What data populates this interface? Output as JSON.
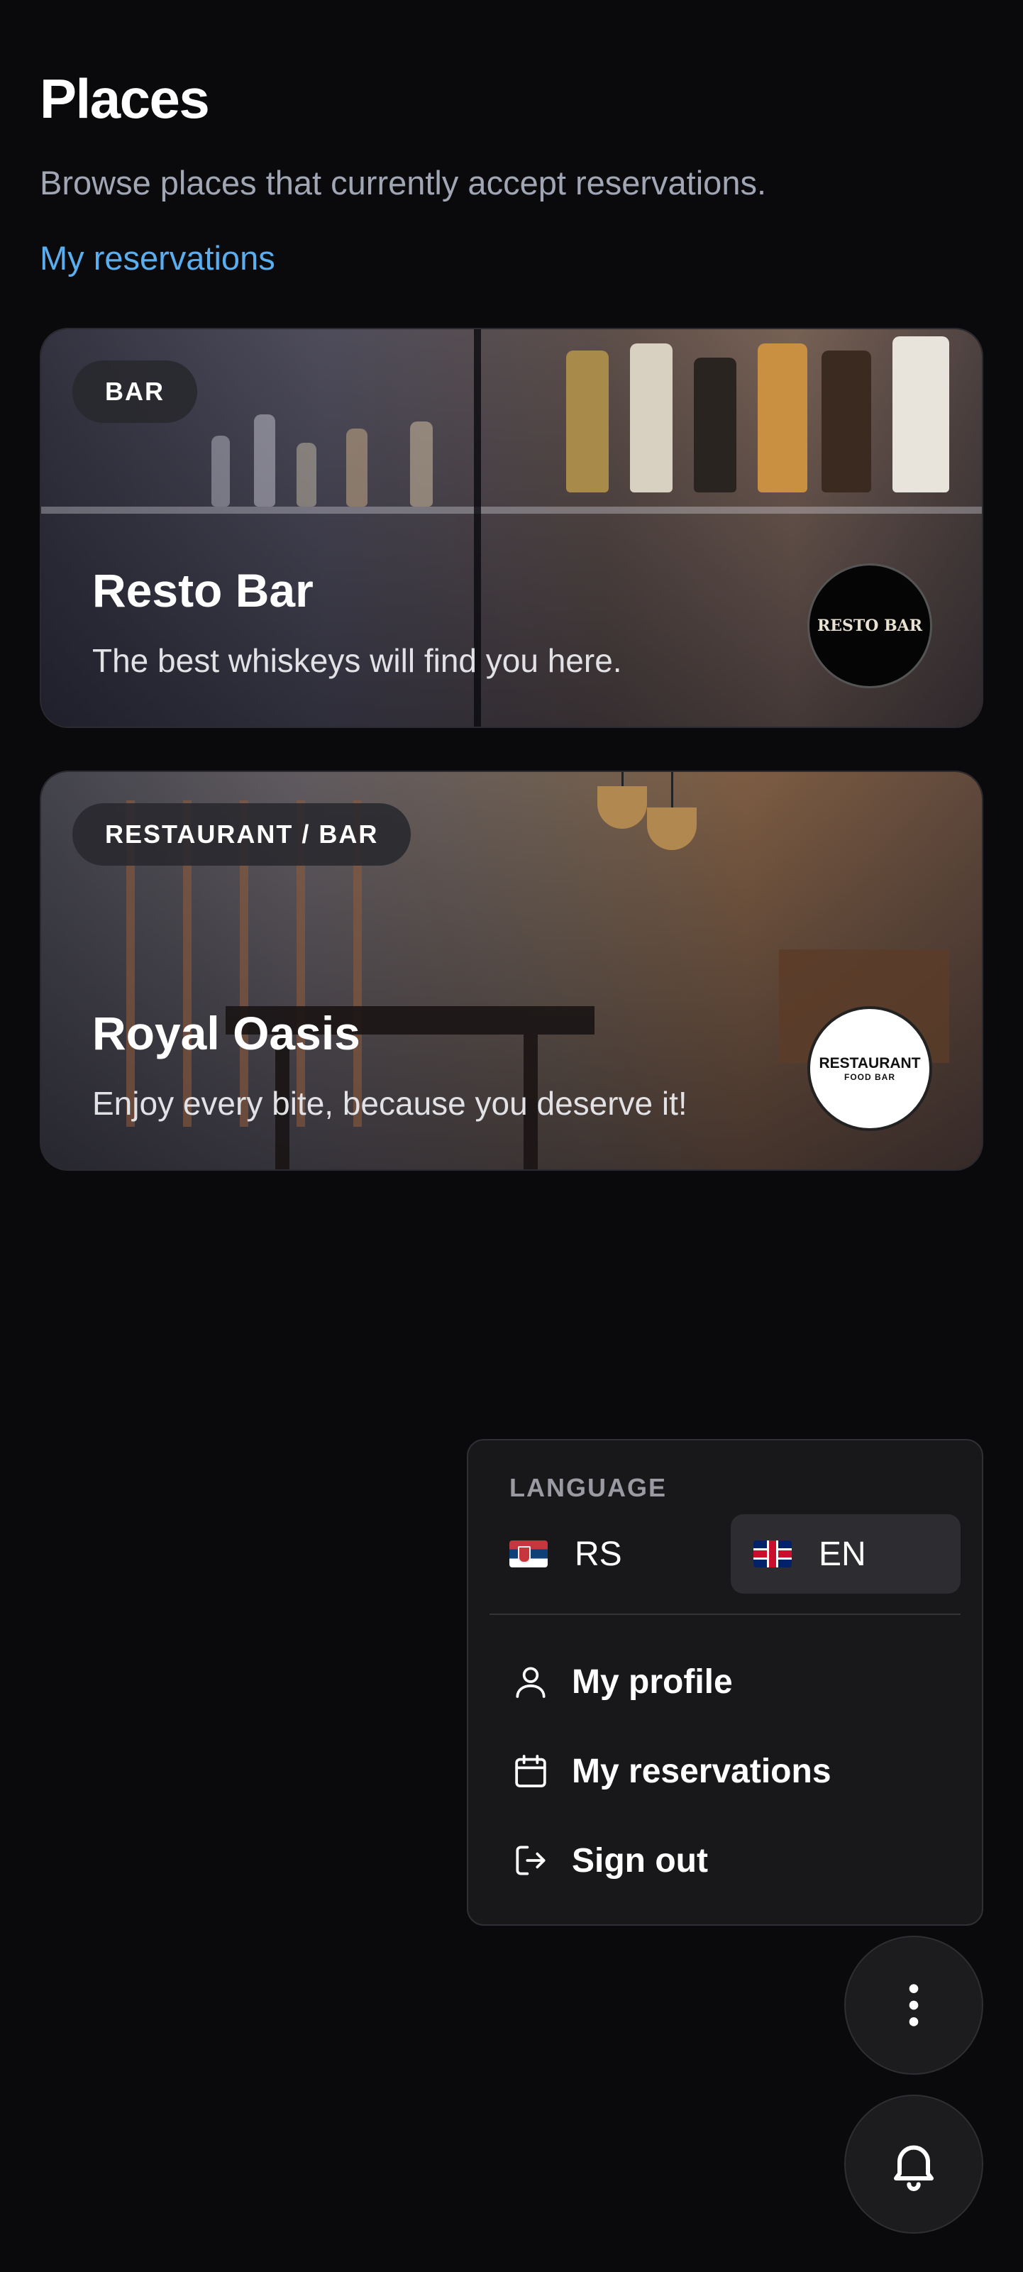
{
  "page": {
    "title": "Places",
    "subtitle": "Browse places that currently accept reservations.",
    "reservations_link": "My reservations"
  },
  "places": [
    {
      "category": "BAR",
      "name": "Resto Bar",
      "description": "The best whiskeys will find you here.",
      "logo_text": "RESTO BAR"
    },
    {
      "category": "RESTAURANT / BAR",
      "name": "Royal Oasis",
      "description": "Enjoy every bite, because you deserve it!",
      "logo_text": "RESTAURANT",
      "logo_subtext": "FOOD BAR"
    }
  ],
  "menu": {
    "section_label": "LANGUAGE",
    "languages": [
      {
        "code": "RS",
        "icon": "serbia-flag-icon",
        "selected": false
      },
      {
        "code": "EN",
        "icon": "uk-flag-icon",
        "selected": true
      }
    ],
    "items": [
      {
        "label": "My profile",
        "icon": "user-icon"
      },
      {
        "label": "My reservations",
        "icon": "calendar-icon"
      },
      {
        "label": "Sign out",
        "icon": "sign-out-icon"
      }
    ]
  },
  "fabs": {
    "more": {
      "icon": "more-vertical-icon"
    },
    "notifications": {
      "icon": "bell-icon"
    }
  },
  "colors": {
    "background": "#0a0a0c",
    "link": "#5aaef0",
    "muted": "#a1a6b4",
    "menu_bg": "#18181b",
    "selected_lang_bg": "#2c2c31"
  }
}
